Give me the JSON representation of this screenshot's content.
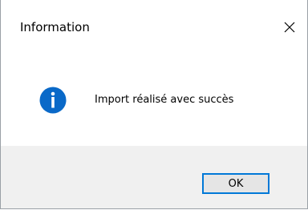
{
  "window": {
    "title": "Information"
  },
  "message": {
    "text": "Import réalisé avec succès",
    "icon": "info-icon"
  },
  "buttons": {
    "ok_label": "OK",
    "close_icon": "close-icon"
  },
  "colors": {
    "accent": "#0078d7",
    "info_icon_bg": "#0a69c8",
    "footer_bg": "#f0f0f0",
    "button_bg": "#e5e5e5"
  }
}
